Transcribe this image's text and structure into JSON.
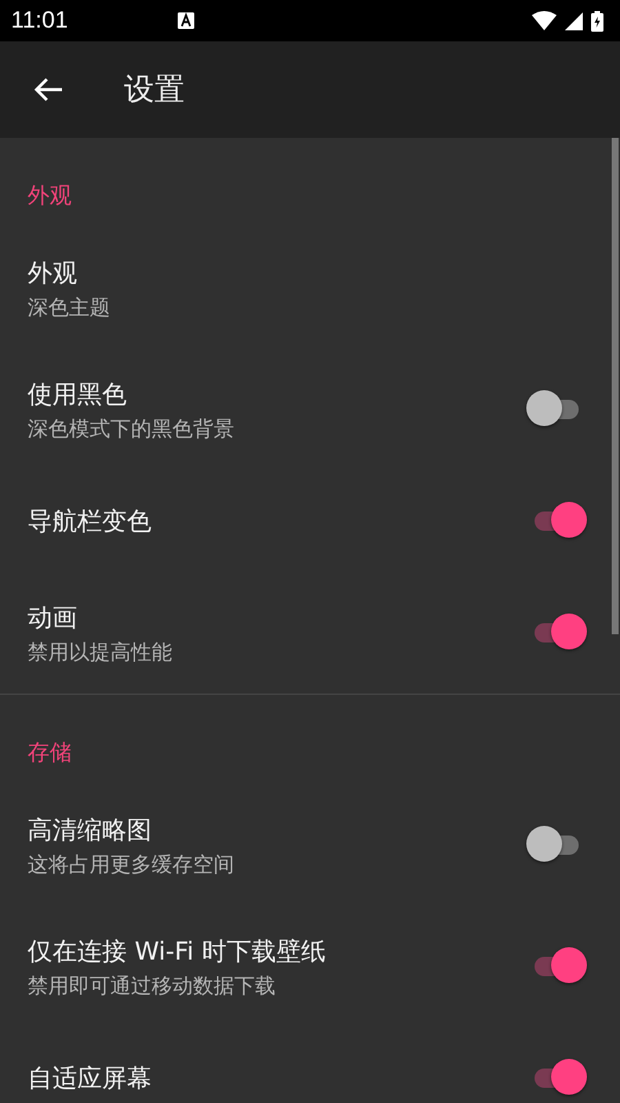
{
  "status_bar": {
    "time": "11:01"
  },
  "app_bar": {
    "title": "设置"
  },
  "sections": [
    {
      "header": "外观",
      "items": [
        {
          "kind": "text",
          "title": "外观",
          "subtitle": "深色主题"
        },
        {
          "kind": "switch",
          "title": "使用黑色",
          "subtitle": "深色模式下的黑色背景",
          "on": false
        },
        {
          "kind": "switch",
          "title": "导航栏变色",
          "on": true
        },
        {
          "kind": "switch",
          "title": "动画",
          "subtitle": "禁用以提高性能",
          "on": true
        }
      ]
    },
    {
      "header": "存储",
      "items": [
        {
          "kind": "switch",
          "title": "高清缩略图",
          "subtitle": "这将占用更多缓存空间",
          "on": false
        },
        {
          "kind": "switch",
          "title": "仅在连接 Wi-Fi 时下载壁纸",
          "subtitle": "禁用即可通过移动数据下载",
          "on": true
        },
        {
          "kind": "switch",
          "title": "自适应屏幕",
          "on": true
        }
      ]
    }
  ]
}
